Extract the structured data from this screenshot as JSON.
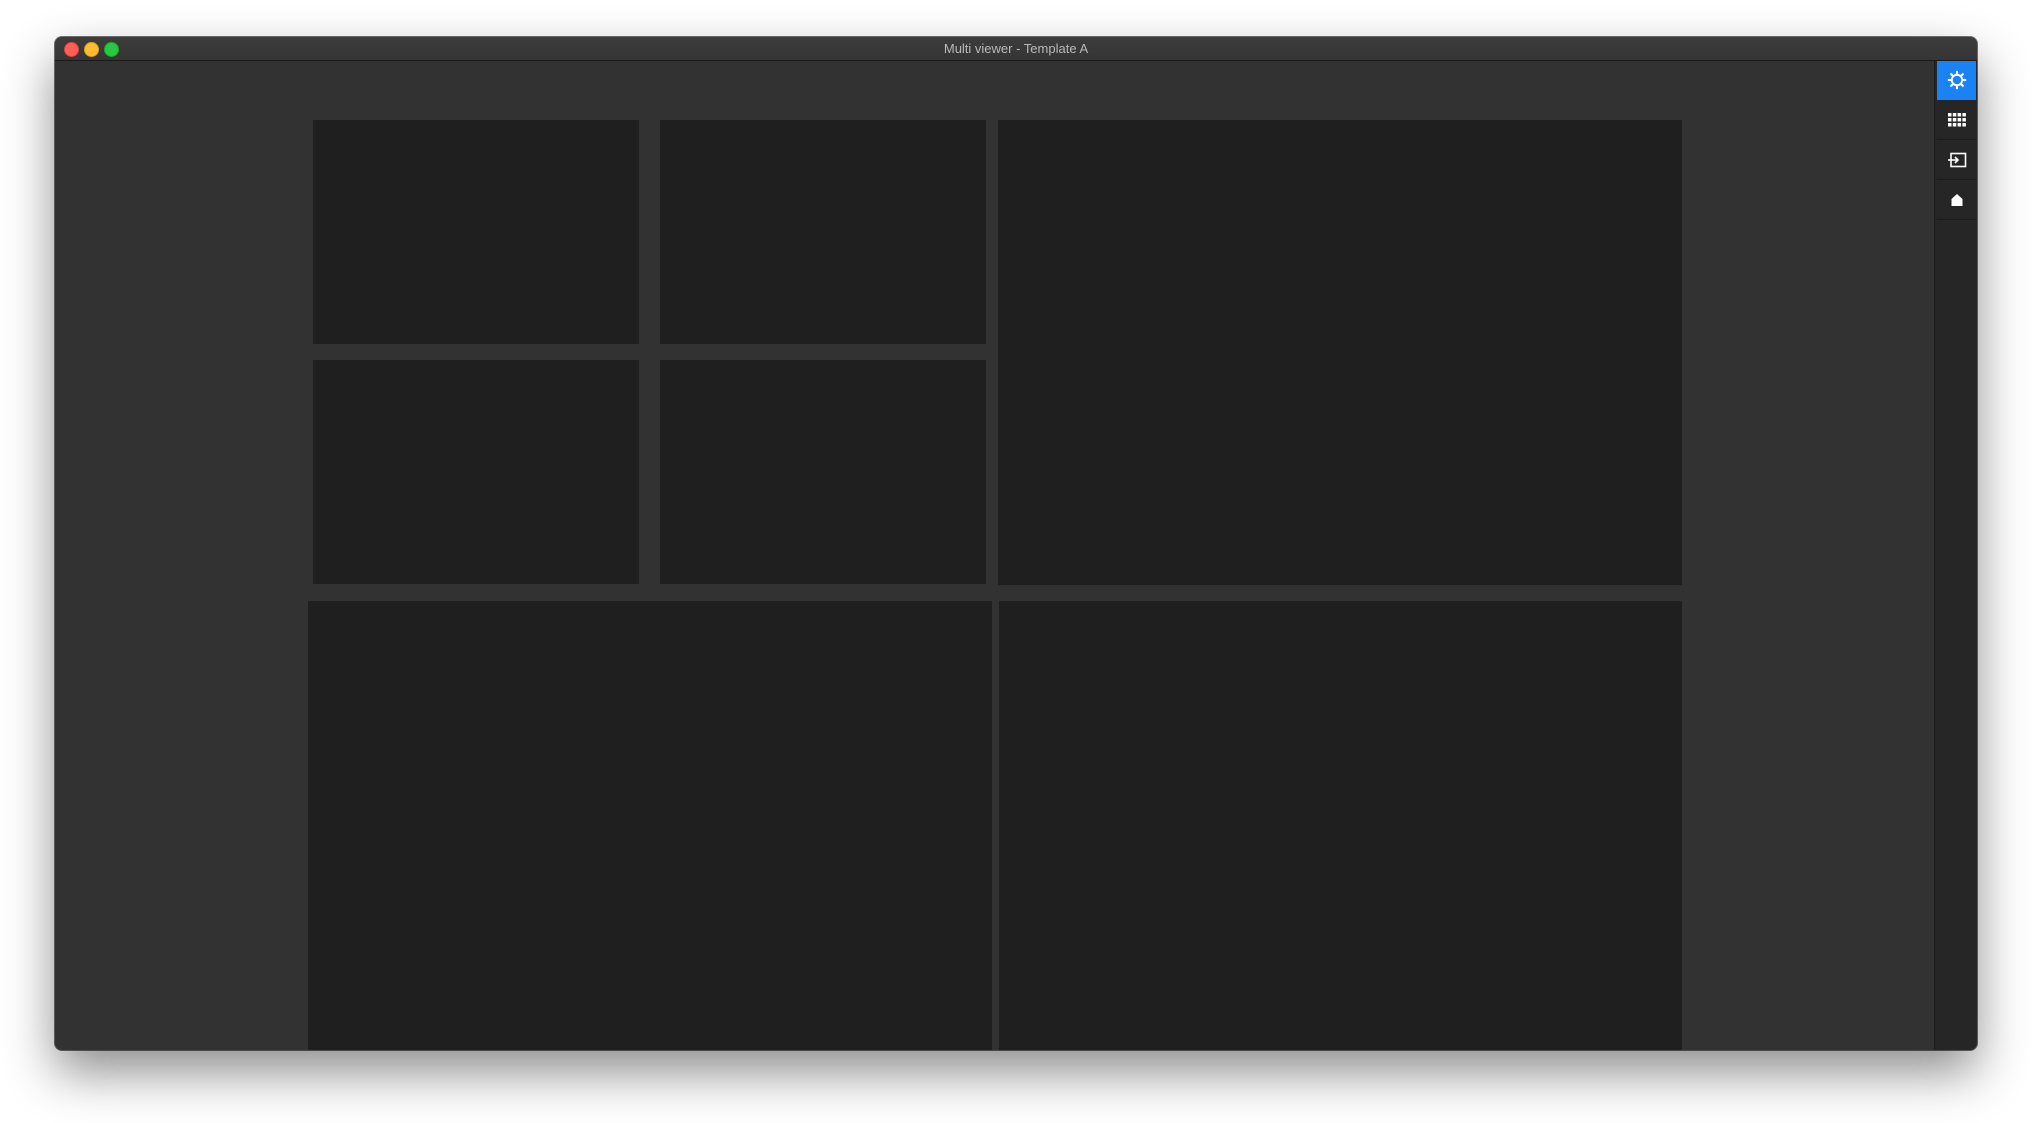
{
  "window": {
    "title": "Multi viewer - Template A"
  },
  "sidebar": {
    "buttons": [
      {
        "icon": "gear-icon",
        "active": true
      },
      {
        "icon": "grid-icon",
        "active": false
      },
      {
        "icon": "input-icon",
        "active": false
      },
      {
        "icon": "home-icon",
        "active": false
      }
    ]
  },
  "colors": {
    "window_bg": "#323232",
    "panel_bg": "#1f1f1f",
    "sidebar_bg": "#262626",
    "accent": "#1a82f2"
  }
}
